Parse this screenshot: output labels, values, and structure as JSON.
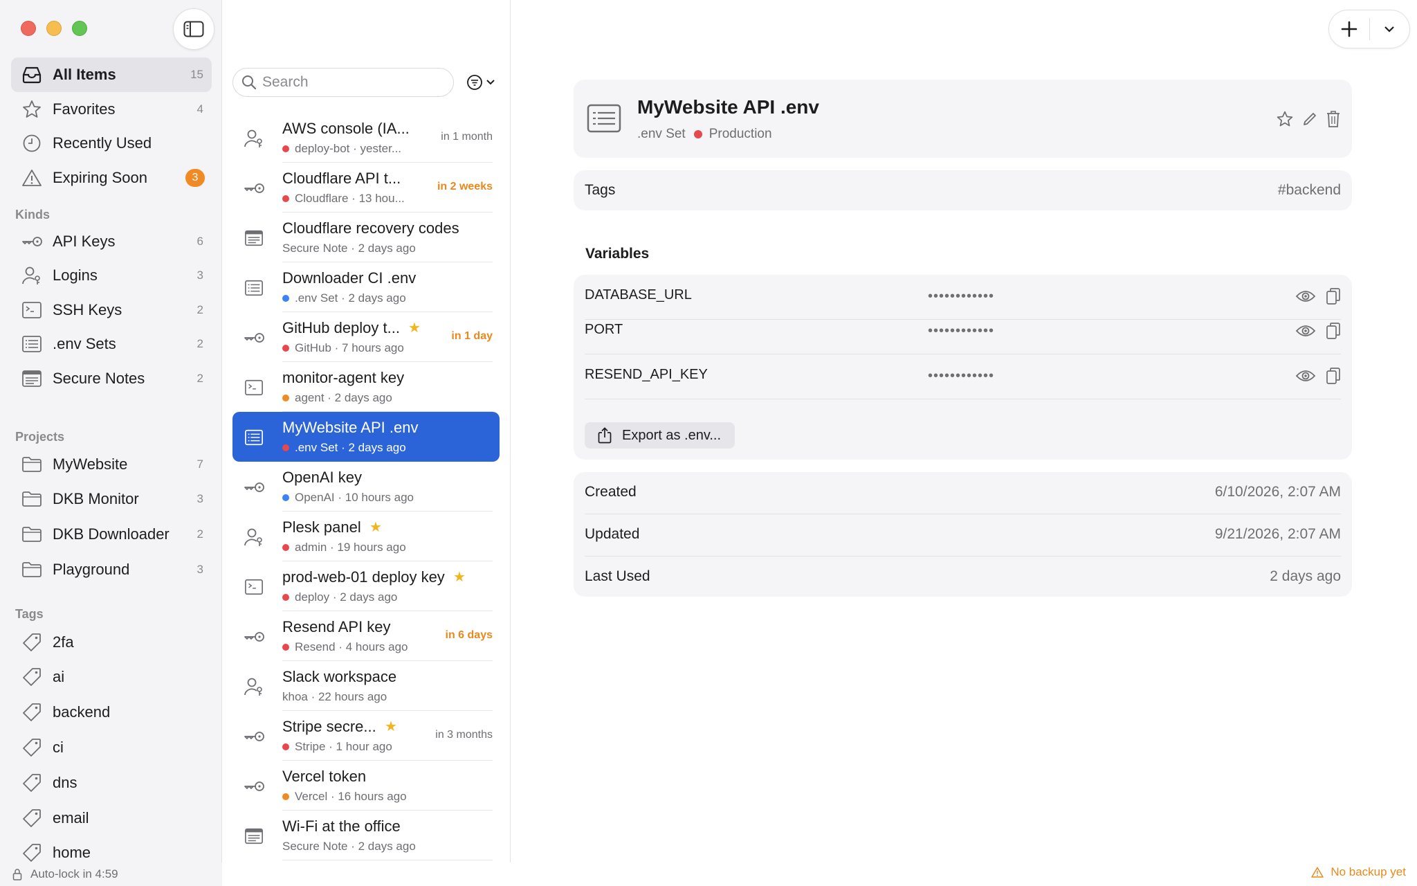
{
  "sidebar": {
    "main_items": [
      {
        "label": "All Items",
        "count": "15",
        "icon": "tray-icon",
        "active": true
      },
      {
        "label": "Favorites",
        "count": "4",
        "icon": "star-icon"
      },
      {
        "label": "Recently Used",
        "count": "",
        "icon": "clock-icon"
      },
      {
        "label": "Expiring Soon",
        "count": "3",
        "icon": "warning-icon",
        "badge": true
      }
    ],
    "kinds_heading": "Kinds",
    "kinds": [
      {
        "label": "API Keys",
        "count": "6",
        "icon": "key-icon"
      },
      {
        "label": "Logins",
        "count": "3",
        "icon": "person-key-icon"
      },
      {
        "label": "SSH Keys",
        "count": "2",
        "icon": "terminal-icon"
      },
      {
        "label": ".env Sets",
        "count": "2",
        "icon": "list-icon"
      },
      {
        "label": "Secure Notes",
        "count": "2",
        "icon": "note-icon"
      }
    ],
    "projects_heading": "Projects",
    "projects": [
      {
        "label": "MyWebsite",
        "count": "7"
      },
      {
        "label": "DKB Monitor",
        "count": "3"
      },
      {
        "label": "DKB Downloader",
        "count": "2"
      },
      {
        "label": "Playground",
        "count": "3"
      }
    ],
    "tags_heading": "Tags",
    "tags": [
      "2fa",
      "ai",
      "backend",
      "ci",
      "dns",
      "email",
      "home"
    ],
    "autolock": "Auto-lock in 4:59"
  },
  "list": {
    "search_placeholder": "Search",
    "items": [
      {
        "title": "AWS console (IA...",
        "sub": "deploy-bot · yester...",
        "dot": "#e5484d",
        "exp": "in 1 month",
        "warn": false,
        "icon": "login"
      },
      {
        "title": "Cloudflare API t...",
        "sub": "Cloudflare · 13 hou...",
        "dot": "#e5484d",
        "exp": "in 2 weeks",
        "warn": true,
        "icon": "key"
      },
      {
        "title": "Cloudflare recovery codes",
        "sub": "Secure Note · 2 days ago",
        "dot": "",
        "exp": "",
        "icon": "note"
      },
      {
        "title": "Downloader CI .env",
        "sub": ".env Set · 2 days ago",
        "dot": "#3b82f6",
        "exp": "",
        "icon": "env"
      },
      {
        "title": "GitHub deploy t...",
        "sub": "GitHub · 7 hours ago",
        "dot": "#e5484d",
        "exp": "in 1 day",
        "warn": true,
        "star": true,
        "icon": "key"
      },
      {
        "title": "monitor-agent key",
        "sub": "agent · 2 days ago",
        "dot": "#f08a24",
        "exp": "",
        "icon": "ssh"
      },
      {
        "title": "MyWebsite API .env",
        "sub": ".env Set · 2 days ago",
        "dot": "#e5484d",
        "exp": "",
        "icon": "env",
        "selected": true
      },
      {
        "title": "OpenAI key",
        "sub": "OpenAI · 10 hours ago",
        "dot": "#3b82f6",
        "exp": "",
        "icon": "key"
      },
      {
        "title": "Plesk panel",
        "sub": "admin · 19 hours ago",
        "dot": "#e5484d",
        "exp": "",
        "star": true,
        "icon": "login"
      },
      {
        "title": "prod-web-01 deploy key",
        "sub": "deploy · 2 days ago",
        "dot": "#e5484d",
        "exp": "",
        "star": true,
        "icon": "ssh"
      },
      {
        "title": "Resend API key",
        "sub": "Resend · 4 hours ago",
        "dot": "#e5484d",
        "exp": "in 6 days",
        "warn": true,
        "icon": "key"
      },
      {
        "title": "Slack workspace",
        "sub": "khoa · 22 hours ago",
        "dot": "",
        "exp": "",
        "icon": "login"
      },
      {
        "title": "Stripe secre...",
        "sub": "Stripe · 1 hour ago",
        "dot": "#e5484d",
        "exp": "in 3 months",
        "warn": false,
        "star": true,
        "icon": "key"
      },
      {
        "title": "Vercel token",
        "sub": "Vercel · 16 hours ago",
        "dot": "#f08a24",
        "exp": "",
        "icon": "key"
      },
      {
        "title": "Wi-Fi at the office",
        "sub": "Secure Note · 2 days ago",
        "dot": "",
        "exp": "",
        "icon": "note"
      }
    ]
  },
  "detail": {
    "title": "MyWebsite API .env",
    "kind": ".env Set",
    "project": "Production",
    "project_color": "#e5484d",
    "tags_label": "Tags",
    "tags_value": "#backend",
    "variables_heading": "Variables",
    "variables": [
      {
        "name": "DATABASE_URL",
        "masked": "••••••••••••"
      },
      {
        "name": "PORT",
        "masked": "••••••••••••"
      },
      {
        "name": "RESEND_API_KEY",
        "masked": "••••••••••••"
      }
    ],
    "export_label": "Export as .env...",
    "meta": [
      {
        "label": "Created",
        "value": "6/10/2026, 2:07 AM"
      },
      {
        "label": "Updated",
        "value": "9/21/2026, 2:07 AM"
      },
      {
        "label": "Last Used",
        "value": "2 days ago"
      }
    ]
  },
  "status": {
    "backup_warning": "No backup yet"
  },
  "colors": {
    "accent": "#2b63d9",
    "warning": "#e8891e",
    "badge": "#f08a24"
  }
}
